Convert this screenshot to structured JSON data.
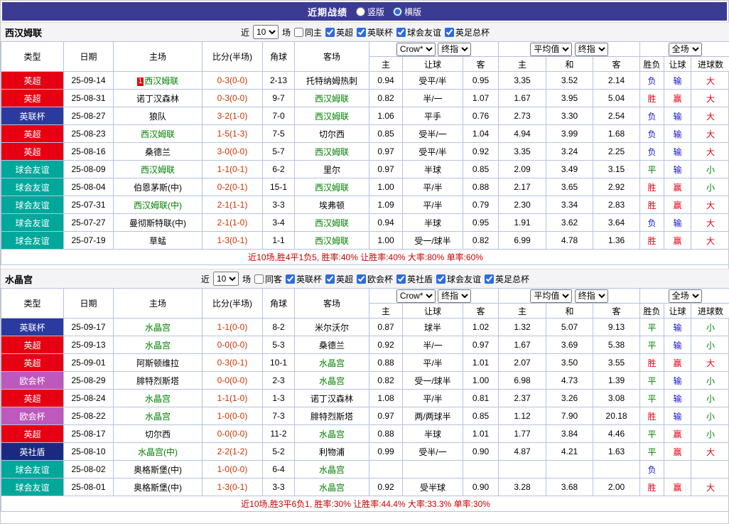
{
  "topbar": {
    "title": "近期战绩",
    "views": [
      {
        "label": "竖版",
        "checked": false
      },
      {
        "label": "横版",
        "checked": true
      }
    ]
  },
  "header": {
    "type": "类型",
    "date": "日期",
    "home": "主场",
    "score": "比分(半场)",
    "corner": "角球",
    "away": "客场",
    "odds_source": "Crow*",
    "odds_final": "终指",
    "avg_source": "平均值",
    "avg_final": "终指",
    "scope": "全场",
    "sub": {
      "odds_home": "主",
      "odds_handicap": "让球",
      "odds_away": "客",
      "avg_home": "主",
      "avg_draw": "和",
      "avg_away": "客",
      "outcome": "胜负",
      "handicap": "让球",
      "goals": "进球数"
    }
  },
  "filter_labels": {
    "near": "近",
    "count": "10",
    "matches": "场"
  },
  "colors": {
    "topbar_bg": "#3c3b94",
    "grid_border": "#b3c3e0",
    "focus_team": "#008000",
    "score": "#cc3300",
    "summary": "#cc0000",
    "type_badges": {
      "英超": "#e60012",
      "英联杯": "#2b3a9e",
      "球会友谊": "#00a79b",
      "欧会杯": "#bd59bd",
      "英社盾": "#1b2a80"
    },
    "outcome": {
      "胜": "#e60012",
      "平": "#008000",
      "负": "#1414cc"
    },
    "handicap": {
      "赢": "#e60012",
      "输": "#1414cc"
    },
    "goals": {
      "大": "#e60012",
      "小": "#008000"
    }
  },
  "sections": [
    {
      "team": "西汉姆联",
      "same_side": {
        "label": "同主",
        "checked": false
      },
      "leagues": [
        {
          "label": "英超",
          "checked": true
        },
        {
          "label": "英联杯",
          "checked": true
        },
        {
          "label": "球会友谊",
          "checked": true
        },
        {
          "label": "英足总杯",
          "checked": true
        }
      ],
      "rows": [
        {
          "type": "英超",
          "date": "25-09-14",
          "badge": "1",
          "home": "西汉姆联",
          "home_focus": true,
          "score": "0-3(0-0)",
          "corners": "2-13",
          "away": "托特纳姆热刺",
          "away_focus": false,
          "odds": [
            "0.94",
            "受平/半",
            "0.95"
          ],
          "avg": [
            "3.35",
            "3.52",
            "2.14"
          ],
          "result": [
            "负",
            "输",
            "大"
          ]
        },
        {
          "type": "英超",
          "date": "25-08-31",
          "home": "诺丁汉森林",
          "home_focus": false,
          "score": "0-3(0-0)",
          "corners": "9-7",
          "away": "西汉姆联",
          "away_focus": true,
          "odds": [
            "0.82",
            "半/一",
            "1.07"
          ],
          "avg": [
            "1.67",
            "3.95",
            "5.04"
          ],
          "result": [
            "胜",
            "赢",
            "大"
          ]
        },
        {
          "type": "英联杯",
          "date": "25-08-27",
          "home": "狼队",
          "home_focus": false,
          "score": "3-2(1-0)",
          "corners": "7-0",
          "away": "西汉姆联",
          "away_focus": true,
          "odds": [
            "1.06",
            "平手",
            "0.76"
          ],
          "avg": [
            "2.73",
            "3.30",
            "2.54"
          ],
          "result": [
            "负",
            "输",
            "大"
          ]
        },
        {
          "type": "英超",
          "date": "25-08-23",
          "home": "西汉姆联",
          "home_focus": true,
          "score": "1-5(1-3)",
          "corners": "7-5",
          "away": "切尔西",
          "away_focus": false,
          "odds": [
            "0.85",
            "受半/一",
            "1.04"
          ],
          "avg": [
            "4.94",
            "3.99",
            "1.68"
          ],
          "result": [
            "负",
            "输",
            "大"
          ]
        },
        {
          "type": "英超",
          "date": "25-08-16",
          "home": "桑德兰",
          "home_focus": false,
          "score": "3-0(0-0)",
          "corners": "5-7",
          "away": "西汉姆联",
          "away_focus": true,
          "odds": [
            "0.97",
            "受平/半",
            "0.92"
          ],
          "avg": [
            "3.35",
            "3.24",
            "2.25"
          ],
          "result": [
            "负",
            "输",
            "大"
          ]
        },
        {
          "type": "球会友谊",
          "date": "25-08-09",
          "home": "西汉姆联",
          "home_focus": true,
          "score": "1-1(0-1)",
          "corners": "6-2",
          "away": "里尔",
          "away_focus": false,
          "odds": [
            "0.97",
            "半球",
            "0.85"
          ],
          "avg": [
            "2.09",
            "3.49",
            "3.15"
          ],
          "result": [
            "平",
            "输",
            "小"
          ]
        },
        {
          "type": "球会友谊",
          "date": "25-08-04",
          "home": "伯恩茅斯(中)",
          "home_focus": false,
          "score": "0-2(0-1)",
          "corners": "15-1",
          "away": "西汉姆联",
          "away_focus": true,
          "odds": [
            "1.00",
            "平/半",
            "0.88"
          ],
          "avg": [
            "2.17",
            "3.65",
            "2.92"
          ],
          "result": [
            "胜",
            "赢",
            "小"
          ]
        },
        {
          "type": "球会友谊",
          "date": "25-07-31",
          "home": "西汉姆联(中)",
          "home_focus": true,
          "score": "2-1(1-1)",
          "corners": "3-3",
          "away": "埃弗顿",
          "away_focus": false,
          "odds": [
            "1.09",
            "平/半",
            "0.79"
          ],
          "avg": [
            "2.30",
            "3.34",
            "2.83"
          ],
          "result": [
            "胜",
            "赢",
            "大"
          ]
        },
        {
          "type": "球会友谊",
          "date": "25-07-27",
          "home": "曼彻斯特联(中)",
          "home_focus": false,
          "score": "2-1(1-0)",
          "corners": "3-4",
          "away": "西汉姆联",
          "away_focus": true,
          "odds": [
            "0.94",
            "半球",
            "0.95"
          ],
          "avg": [
            "1.91",
            "3.62",
            "3.64"
          ],
          "result": [
            "负",
            "输",
            "大"
          ]
        },
        {
          "type": "球会友谊",
          "date": "25-07-19",
          "home": "草蜢",
          "home_focus": false,
          "score": "1-3(0-1)",
          "corners": "1-1",
          "away": "西汉姆联",
          "away_focus": true,
          "odds": [
            "1.00",
            "受一/球半",
            "0.82"
          ],
          "avg": [
            "6.99",
            "4.78",
            "1.36"
          ],
          "result": [
            "胜",
            "赢",
            "大"
          ]
        }
      ],
      "summary": "近10场,胜4平1负5, 胜率:40% 让胜率:40% 大率:80% 单率:60%"
    },
    {
      "team": "水晶宫",
      "same_side": {
        "label": "同客",
        "checked": false
      },
      "leagues": [
        {
          "label": "英联杯",
          "checked": true
        },
        {
          "label": "英超",
          "checked": true
        },
        {
          "label": "欧会杯",
          "checked": true
        },
        {
          "label": "英社盾",
          "checked": true
        },
        {
          "label": "球会友谊",
          "checked": true
        },
        {
          "label": "英足总杯",
          "checked": true
        }
      ],
      "rows": [
        {
          "type": "英联杯",
          "date": "25-09-17",
          "home": "水晶宫",
          "home_focus": true,
          "score": "1-1(0-0)",
          "corners": "8-2",
          "away": "米尔沃尔",
          "away_focus": false,
          "odds": [
            "0.87",
            "球半",
            "1.02"
          ],
          "avg": [
            "1.32",
            "5.07",
            "9.13"
          ],
          "result": [
            "平",
            "输",
            "小"
          ]
        },
        {
          "type": "英超",
          "date": "25-09-13",
          "home": "水晶宫",
          "home_focus": true,
          "score": "0-0(0-0)",
          "corners": "5-3",
          "away": "桑德兰",
          "away_focus": false,
          "odds": [
            "0.92",
            "半/一",
            "0.97"
          ],
          "avg": [
            "1.67",
            "3.69",
            "5.38"
          ],
          "result": [
            "平",
            "输",
            "小"
          ]
        },
        {
          "type": "英超",
          "date": "25-09-01",
          "home": "阿斯顿维拉",
          "home_focus": false,
          "score": "0-3(0-1)",
          "corners": "10-1",
          "away": "水晶宫",
          "away_focus": true,
          "odds": [
            "0.88",
            "平/半",
            "1.01"
          ],
          "avg": [
            "2.07",
            "3.50",
            "3.55"
          ],
          "result": [
            "胜",
            "赢",
            "大"
          ]
        },
        {
          "type": "欧会杯",
          "date": "25-08-29",
          "home": "腓特烈斯塔",
          "home_focus": false,
          "score": "0-0(0-0)",
          "corners": "2-3",
          "away": "水晶宫",
          "away_focus": true,
          "odds": [
            "0.82",
            "受一/球半",
            "1.00"
          ],
          "avg": [
            "6.98",
            "4.73",
            "1.39"
          ],
          "result": [
            "平",
            "输",
            "小"
          ]
        },
        {
          "type": "英超",
          "date": "25-08-24",
          "home": "水晶宫",
          "home_focus": true,
          "score": "1-1(1-0)",
          "corners": "1-3",
          "away": "诺丁汉森林",
          "away_focus": false,
          "odds": [
            "1.08",
            "平/半",
            "0.81"
          ],
          "avg": [
            "2.37",
            "3.26",
            "3.08"
          ],
          "result": [
            "平",
            "输",
            "小"
          ]
        },
        {
          "type": "欧会杯",
          "date": "25-08-22",
          "home": "水晶宫",
          "home_focus": true,
          "score": "1-0(0-0)",
          "corners": "7-3",
          "away": "腓特烈斯塔",
          "away_focus": false,
          "odds": [
            "0.97",
            "两/两球半",
            "0.85"
          ],
          "avg": [
            "1.12",
            "7.90",
            "20.18"
          ],
          "result": [
            "胜",
            "输",
            "小"
          ]
        },
        {
          "type": "英超",
          "date": "25-08-17",
          "home": "切尔西",
          "home_focus": false,
          "score": "0-0(0-0)",
          "corners": "11-2",
          "away": "水晶宫",
          "away_focus": true,
          "odds": [
            "0.88",
            "半球",
            "1.01"
          ],
          "avg": [
            "1.77",
            "3.84",
            "4.46"
          ],
          "result": [
            "平",
            "赢",
            "小"
          ]
        },
        {
          "type": "英社盾",
          "date": "25-08-10",
          "home": "水晶宫(中)",
          "home_focus": true,
          "score": "2-2(1-2)",
          "corners": "5-2",
          "away": "利物浦",
          "away_focus": false,
          "odds": [
            "0.99",
            "受半/一",
            "0.90"
          ],
          "avg": [
            "4.87",
            "4.21",
            "1.63"
          ],
          "result": [
            "平",
            "赢",
            "大"
          ]
        },
        {
          "type": "球会友谊",
          "date": "25-08-02",
          "home": "奥格斯堡(中)",
          "home_focus": false,
          "score": "1-0(0-0)",
          "corners": "6-4",
          "away": "水晶宫",
          "away_focus": true,
          "odds": [
            "",
            "",
            ""
          ],
          "avg": [
            "",
            "",
            ""
          ],
          "result": [
            "负",
            "",
            ""
          ]
        },
        {
          "type": "球会友谊",
          "date": "25-08-01",
          "home": "奥格斯堡(中)",
          "home_focus": false,
          "score": "1-3(0-1)",
          "corners": "3-3",
          "away": "水晶宫",
          "away_focus": true,
          "odds": [
            "0.92",
            "受半球",
            "0.90"
          ],
          "avg": [
            "3.28",
            "3.68",
            "2.00"
          ],
          "result": [
            "胜",
            "赢",
            "大"
          ]
        }
      ],
      "summary": "近10场,胜3平6负1, 胜率:30% 让胜率:44.4% 大率:33.3% 单率:30%"
    }
  ]
}
